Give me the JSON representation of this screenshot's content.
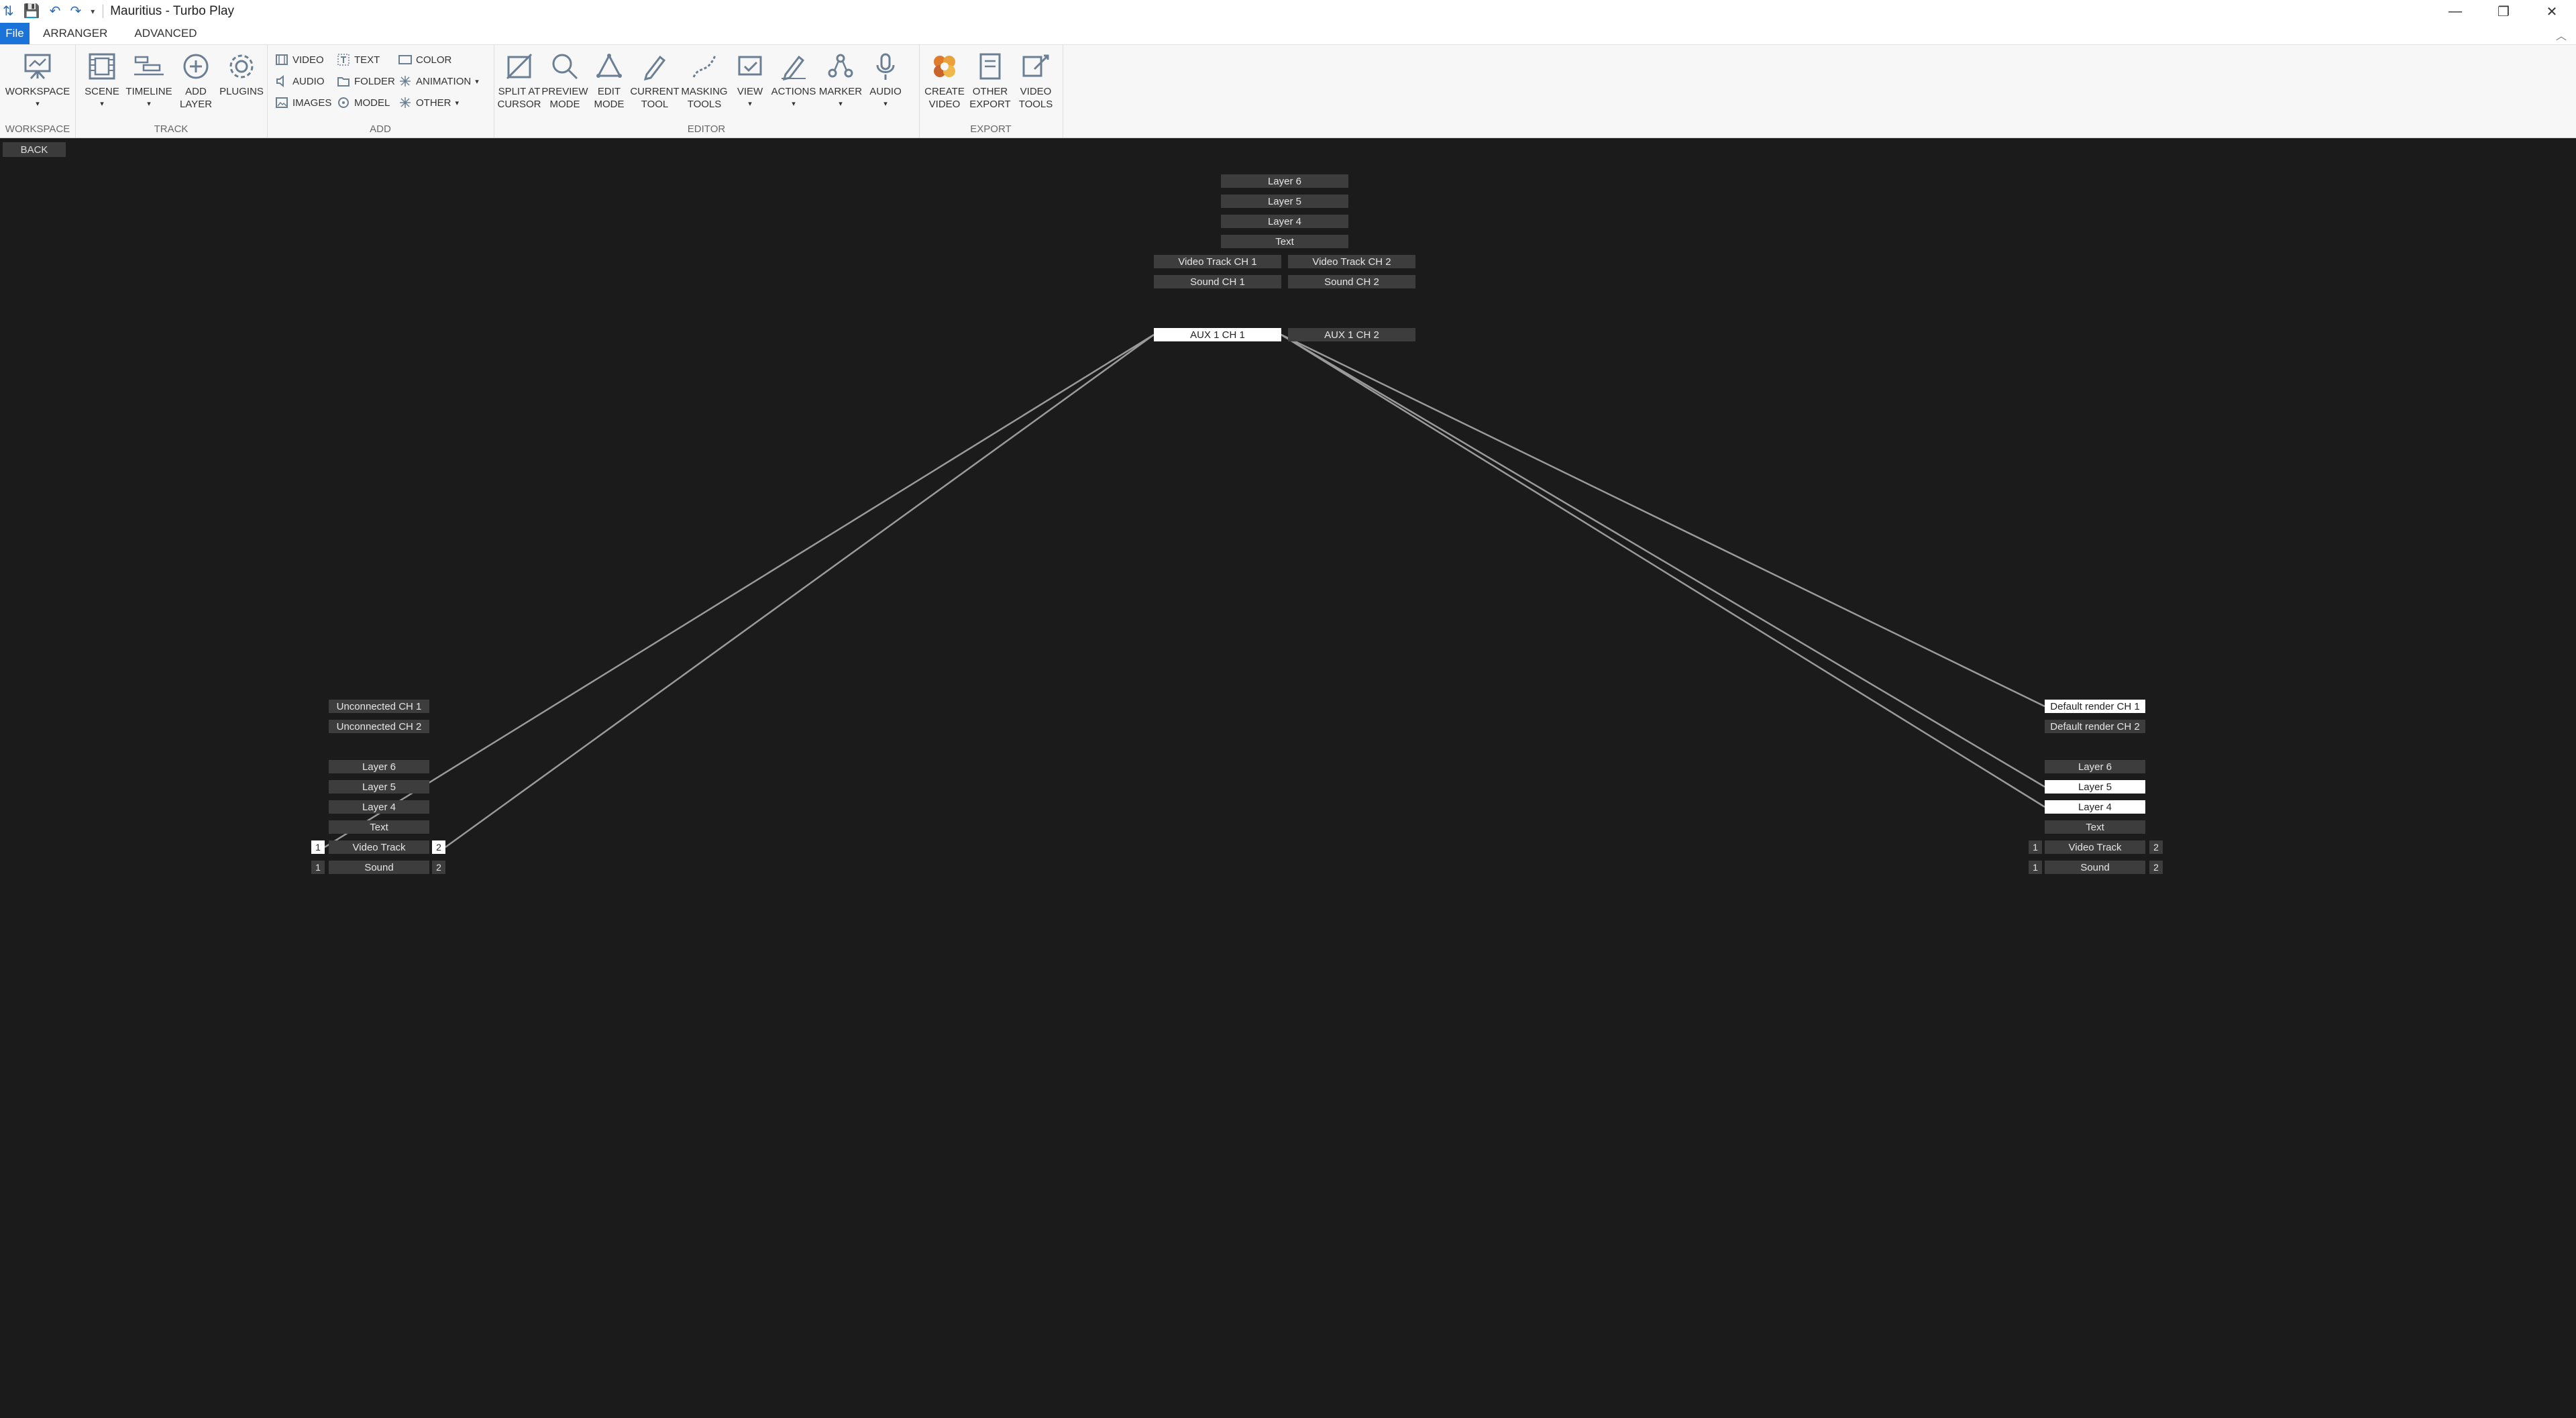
{
  "titlebar": {
    "title": "Mauritius - Turbo Play",
    "controls": [
      "minimize-icon",
      "restore-icon",
      "close-icon"
    ]
  },
  "menubar": {
    "tabs": [
      "File",
      "ARRANGER",
      "ADVANCED"
    ]
  },
  "ribbon": {
    "groups": {
      "workspace": "WORKSPACE",
      "track": "TRACK",
      "add": "ADD",
      "editor": "EDITOR",
      "export": "EXPORT"
    },
    "buttons": {
      "workspace": "WORKSPACE",
      "scene": "SCENE",
      "timeline": "TIMELINE",
      "add_layer": "ADD\nLAYER",
      "plugins": "PLUGINS",
      "video": "VIDEO",
      "audio_add": "AUDIO",
      "images": "IMAGES",
      "text": "TEXT",
      "folder": "FOLDER",
      "model": "MODEL",
      "color": "COLOR",
      "animation": "ANIMATION",
      "other": "OTHER",
      "split_at_cursor": "SPLIT AT\nCURSOR",
      "preview_mode": "PREVIEW\nMODE",
      "edit_mode": "EDIT\nMODE",
      "current_tool": "CURRENT\nTOOL",
      "masking_tools": "MASKING\nTOOLS",
      "view": "VIEW",
      "actions": "ACTIONS",
      "marker": "MARKER",
      "audio_editor": "AUDIO",
      "create_video": "CREATE\nVIDEO",
      "other_export": "OTHER\nEXPORT",
      "video_tools": "VIDEO\nTOOLS"
    }
  },
  "back_label": "BACK",
  "routing": {
    "aux": {
      "layer6": "Layer 6",
      "layer5": "Layer 5",
      "layer4": "Layer 4",
      "text": "Text",
      "video_ch1": "Video Track CH 1",
      "video_ch2": "Video Track CH 2",
      "sound_ch1": "Sound CH 1",
      "sound_ch2": "Sound CH 2",
      "aux1_ch1": "AUX 1 CH 1",
      "aux1_ch2": "AUX 1 CH 2"
    },
    "left": {
      "unconnected_ch1": "Unconnected CH 1",
      "unconnected_ch2": "Unconnected CH 2",
      "layer6": "Layer 6",
      "layer5": "Layer 5",
      "layer4": "Layer 4",
      "text": "Text",
      "video_track": "Video Track",
      "sound": "Sound",
      "port1": "1",
      "port2": "2"
    },
    "right": {
      "default_ch1": "Default render CH 1",
      "default_ch2": "Default render CH 2",
      "layer6": "Layer 6",
      "layer5": "Layer 5",
      "layer4": "Layer 4",
      "text": "Text",
      "video_track": "Video Track",
      "sound": "Sound",
      "port1": "1",
      "port2": "2"
    },
    "colors": {
      "background": "#1b1b1b",
      "node": "#3d3d3d",
      "node_active": "#ffffff",
      "wire": "#9a9a9a"
    }
  }
}
